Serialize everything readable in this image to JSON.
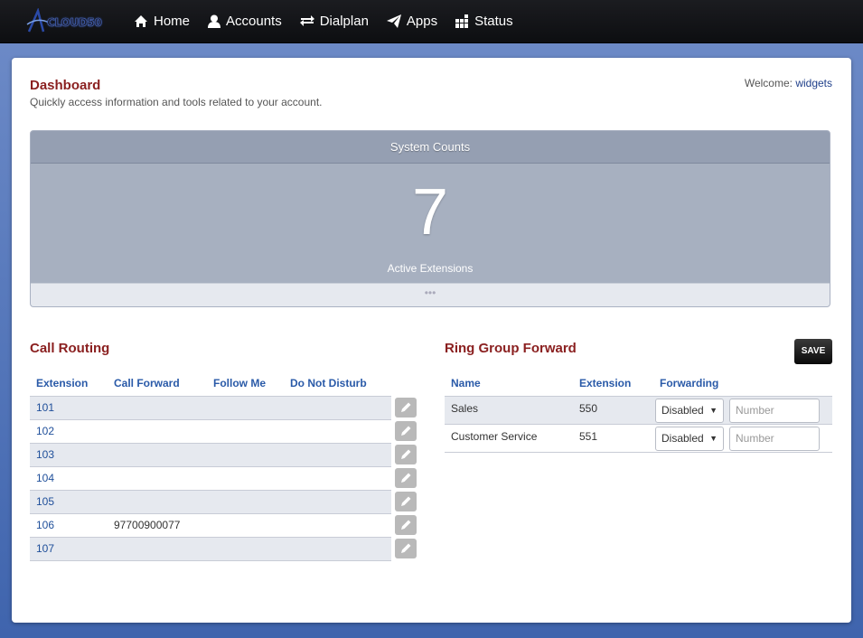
{
  "brand": {
    "logo_text": "CLOUD50"
  },
  "nav": [
    {
      "label": "Home",
      "icon": "home-icon"
    },
    {
      "label": "Accounts",
      "icon": "user-icon"
    },
    {
      "label": "Dialplan",
      "icon": "exchange-arrows-icon"
    },
    {
      "label": "Apps",
      "icon": "paper-plane-icon"
    },
    {
      "label": "Status",
      "icon": "grid-icon"
    }
  ],
  "page": {
    "title": "Dashboard",
    "subtitle": "Quickly access information and tools related to your account.",
    "welcome_label": "Welcome:",
    "welcome_user": "widgets"
  },
  "system_counts": {
    "title": "System Counts",
    "value": "7",
    "label": "Active Extensions",
    "footer": "•••"
  },
  "call_routing": {
    "title": "Call Routing",
    "columns": [
      "Extension",
      "Call Forward",
      "Follow Me",
      "Do Not Disturb"
    ],
    "rows": [
      {
        "extension": "101",
        "call_forward": "",
        "follow_me": "",
        "dnd": ""
      },
      {
        "extension": "102",
        "call_forward": "",
        "follow_me": "",
        "dnd": ""
      },
      {
        "extension": "103",
        "call_forward": "",
        "follow_me": "",
        "dnd": ""
      },
      {
        "extension": "104",
        "call_forward": "",
        "follow_me": "",
        "dnd": ""
      },
      {
        "extension": "105",
        "call_forward": "",
        "follow_me": "",
        "dnd": ""
      },
      {
        "extension": "106",
        "call_forward": "97700900077",
        "follow_me": "",
        "dnd": ""
      },
      {
        "extension": "107",
        "call_forward": "",
        "follow_me": "",
        "dnd": ""
      }
    ]
  },
  "ring_group": {
    "title": "Ring Group Forward",
    "save_label": "SAVE",
    "columns": [
      "Name",
      "Extension",
      "Forwarding"
    ],
    "rows": [
      {
        "name": "Sales",
        "extension": "550",
        "forwarding": "Disabled",
        "number_placeholder": "Number"
      },
      {
        "name": "Customer Service",
        "extension": "551",
        "forwarding": "Disabled",
        "number_placeholder": "Number"
      }
    ]
  },
  "colors": {
    "accent_red": "#8a1f1f",
    "link_blue": "#2a5aa8",
    "panel_gray": "#a7b0c0"
  }
}
